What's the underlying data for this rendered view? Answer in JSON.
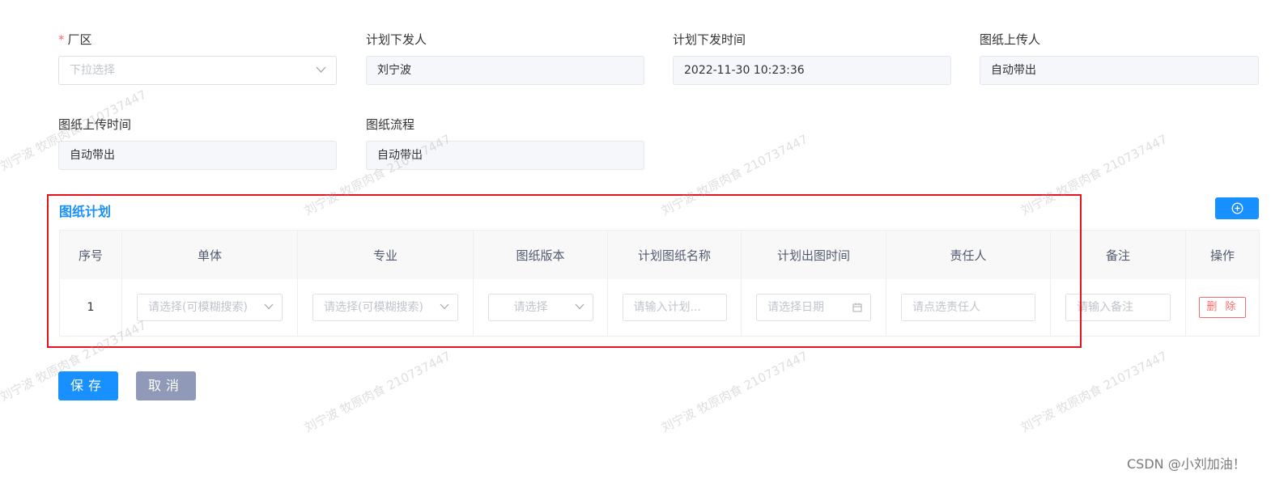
{
  "form": {
    "factory": {
      "label": "厂区",
      "required_mark": "*",
      "placeholder": "下拉选择"
    },
    "plan_issuer": {
      "label": "计划下发人",
      "value": "刘宁波"
    },
    "plan_issue_time": {
      "label": "计划下发时间",
      "value": "2022-11-30 10:23:36"
    },
    "drawing_uploader": {
      "label": "图纸上传人",
      "value": "自动带出"
    },
    "drawing_upload_time": {
      "label": "图纸上传时间",
      "value": "自动带出"
    },
    "drawing_process": {
      "label": "图纸流程",
      "value": "自动带出"
    }
  },
  "plan_section": {
    "title": "图纸计划",
    "columns": [
      "序号",
      "单体",
      "专业",
      "图纸版本",
      "计划图纸名称",
      "计划出图时间",
      "责任人",
      "备注",
      "操作"
    ],
    "row": {
      "index": "1",
      "unit_placeholder": "请选择(可模糊搜索)",
      "discipline_placeholder": "请选择(可模糊搜索)",
      "version_placeholder": "请选择",
      "name_placeholder": "请输入计划...",
      "date_placeholder": "请选择日期",
      "owner_placeholder": "请点选责任人",
      "remark_placeholder": "请输入备注",
      "delete_label": "删 除"
    }
  },
  "actions": {
    "save_label": "保存",
    "cancel_label": "取消"
  },
  "watermark_text": "刘宁波 牧原肉食 210737447",
  "footer_credit": "CSDN @小刘加油！",
  "colors": {
    "primary": "#1890ff",
    "danger": "#f56c6c",
    "highlight": "#e5131d",
    "cancel": "#909ab8"
  }
}
